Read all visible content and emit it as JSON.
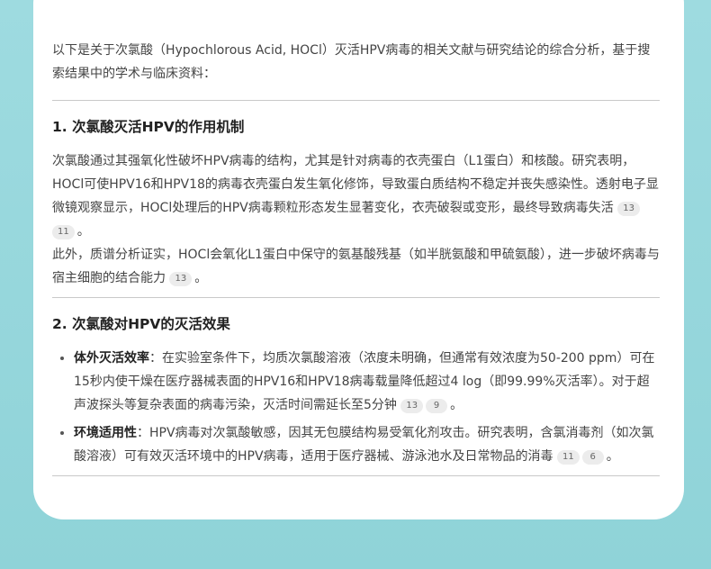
{
  "intro": "以下是关于次氯酸（Hypochlorous Acid, HOCl）灭活HPV病毒的相关文献与研究结论的综合分析，基于搜索结果中的学术与临床资料：",
  "sections": [
    {
      "heading": "1. 次氯酸灭活HPV的作用机制",
      "paragraphs": [
        {
          "text": "次氯酸通过其强氧化性破坏HPV病毒的结构，尤其是针对病毒的衣壳蛋白（L1蛋白）和核酸。研究表明，HOCl可使HPV16和HPV18的病毒衣壳蛋白发生氧化修饰，导致蛋白质结构不稳定并丧失感染性。透射电子显微镜观察显示，HOCl处理后的HPV病毒颗粒形态发生显著变化，衣壳破裂或变形，最终导致病毒失活",
          "cites": [
            "13",
            "11"
          ],
          "end": "。"
        },
        {
          "text": "此外，质谱分析证实，HOCl会氧化L1蛋白中保守的氨基酸残基（如半胱氨酸和甲硫氨酸），进一步破坏病毒与宿主细胞的结合能力",
          "cites": [
            "13"
          ],
          "end": "。"
        }
      ]
    },
    {
      "heading": "2. 次氯酸对HPV的灭活效果",
      "items": [
        {
          "term": "体外灭活效率",
          "sep": "：",
          "text": "在实验室条件下，均质次氯酸溶液（浓度未明确，但通常有效浓度为50-200 ppm）可在15秒内使干燥在医疗器械表面的HPV16和HPV18病毒载量降低超过4 log（即99.99%灭活率）。对于超声波探头等复杂表面的病毒污染，灭活时间需延长至5分钟",
          "cites": [
            "13",
            "9"
          ],
          "end": "。"
        },
        {
          "term": "环境适用性",
          "sep": "：",
          "text": "HPV病毒对次氯酸敏感，因其无包膜结构易受氧化剂攻击。研究表明，含氯消毒剂（如次氯酸溶液）可有效灭活环境中的HPV病毒，适用于医疗器械、游泳池水及日常物品的消毒",
          "cites": [
            "11",
            "6"
          ],
          "end": "。"
        }
      ]
    }
  ]
}
